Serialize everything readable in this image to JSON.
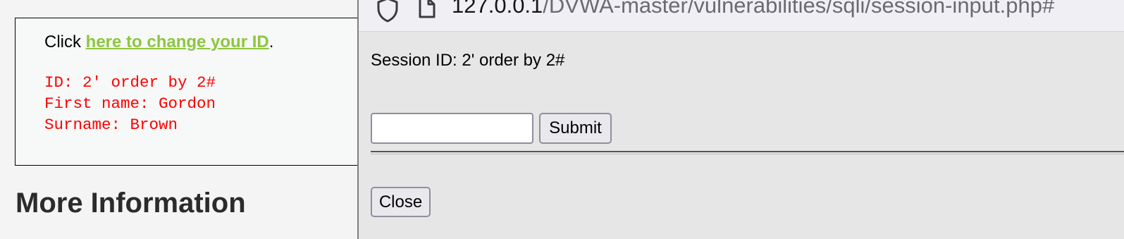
{
  "background_page": {
    "click_prefix": "Click ",
    "click_link": "here to change your ID",
    "click_suffix": ".",
    "result_lines": [
      "ID: 2' order by 2#",
      "First name: Gordon",
      "Surname: Brown"
    ],
    "more_info_heading": "More Information"
  },
  "popup": {
    "url_host": "127.0.0.1",
    "url_path": "/DVWA-master/vulnerabilities/sqli/session-input.php#",
    "session_text": "Session ID: 2' order by 2#",
    "input_value": "",
    "submit_label": "Submit",
    "close_label": "Close"
  },
  "icons": {
    "url_security": "shield-icon",
    "url_page": "page-icon"
  },
  "colors": {
    "link": "#8dc63f",
    "result_text": "#ff0000",
    "popup_bg": "#e6e6e6",
    "url_bar_bg": "#f0f0f4"
  }
}
